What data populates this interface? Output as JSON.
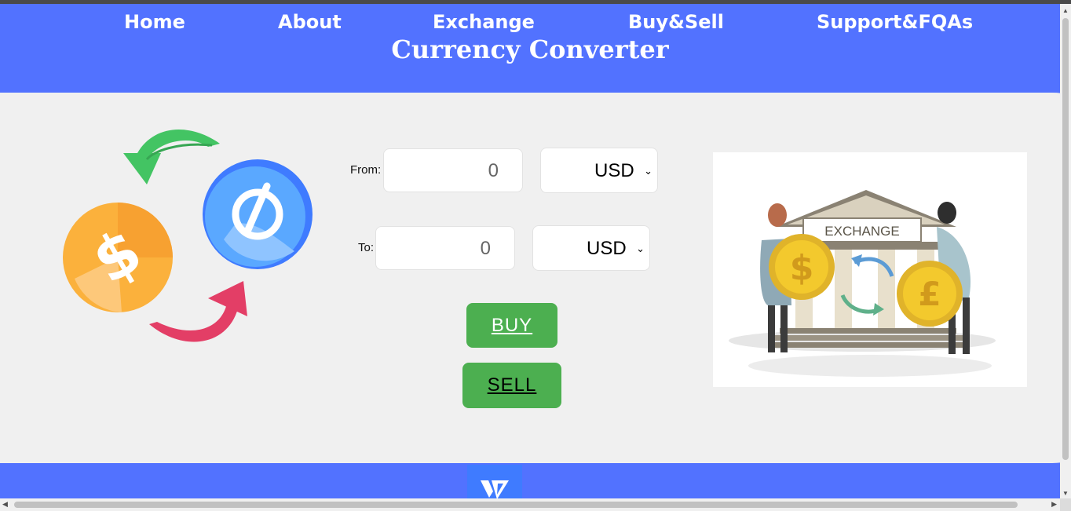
{
  "nav": {
    "items": [
      {
        "label": "Home"
      },
      {
        "label": "About"
      },
      {
        "label": "Exchange"
      },
      {
        "label": "Buy&Sell"
      },
      {
        "label": "Support&FQAs"
      }
    ]
  },
  "page": {
    "title": "Currency Converter"
  },
  "converter": {
    "from_label": "From:",
    "from_value": "0",
    "from_currency": "USD",
    "to_label": "To:",
    "to_value": "0",
    "to_currency": "USD",
    "buy_label": "BUY",
    "sell_label": "SELL"
  },
  "illustration": {
    "sign_text": "EXCHANGE"
  },
  "colors": {
    "header_bg": "#5272ff",
    "card_bg": "#f0f0f0",
    "button_green": "#4caf50",
    "logo_blue": "#3f7bff"
  },
  "icons": {
    "left_art": [
      "dollar-coin-icon",
      "blue-coin-icon",
      "green-arrow-icon",
      "red-arrow-icon"
    ],
    "footer_logo": "vl-logo-icon"
  }
}
